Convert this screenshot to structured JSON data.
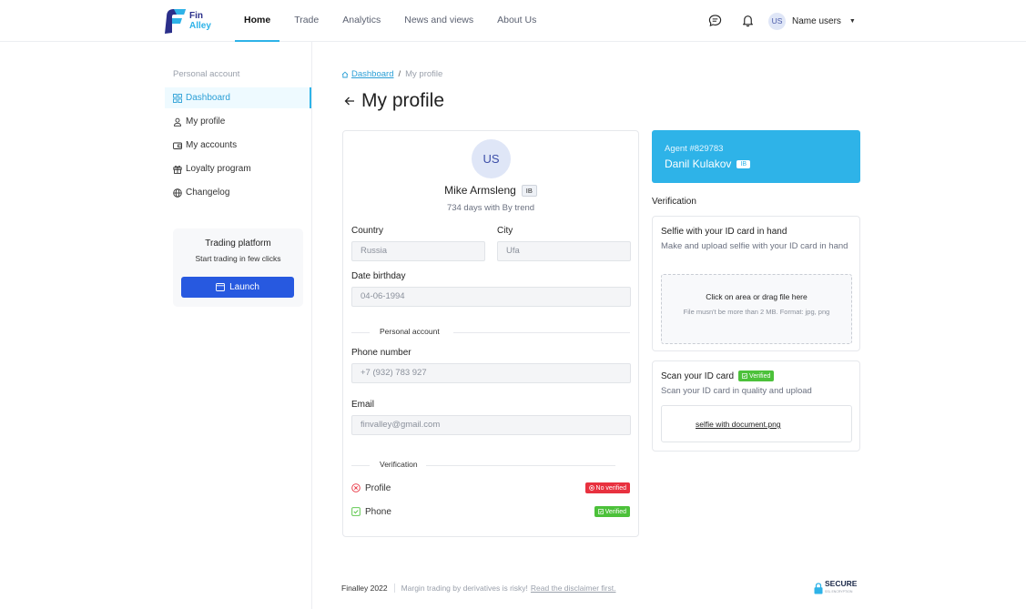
{
  "colors": {
    "accent": "#2eb3e8",
    "primary_button": "#2759e0",
    "danger": "#e8313f",
    "success": "#4cc13a"
  },
  "header": {
    "logo": {
      "line1": "Fin",
      "line2": "Alley"
    },
    "nav": [
      "Home",
      "Trade",
      "Analytics",
      "News and views",
      "About Us"
    ],
    "active_nav": "Home",
    "icons": [
      "chat-icon",
      "bell-icon"
    ],
    "user": {
      "initials": "US",
      "name": "Name users"
    }
  },
  "sidebar": {
    "title": "Personal account",
    "items": [
      {
        "label": "Dashboard",
        "icon": "grid-icon",
        "active": true
      },
      {
        "label": "My profile",
        "icon": "user-icon",
        "active": false
      },
      {
        "label": "My accounts",
        "icon": "wallet-icon",
        "active": false
      },
      {
        "label": "Loyalty program",
        "icon": "gift-icon",
        "active": false
      },
      {
        "label": "Changelog",
        "icon": "globe-icon",
        "active": false
      }
    ],
    "trading": {
      "title": "Trading platform",
      "subtitle": "Start trading in few clicks",
      "button": "Launch"
    }
  },
  "breadcrumb": {
    "link": "Dashboard",
    "current": "My profile"
  },
  "page_title": "My profile",
  "profile": {
    "initials": "US",
    "name": "Mike Armsleng",
    "tag": "IB",
    "days": "734 days with By trend",
    "fields": {
      "country_label": "Country",
      "country_value": "Russia",
      "city_label": "City",
      "city_value": "Ufa",
      "birthday_label": "Date birthday",
      "birthday_value": "04-06-1994",
      "section_personal": "Personal account",
      "phone_label": "Phone number",
      "phone_value": "+7 (932) 783 927",
      "email_label": "Email",
      "email_value": "finvalley@gmail.com",
      "section_verification": "Verification"
    },
    "verification": [
      {
        "label": "Profile",
        "status": "No verified"
      },
      {
        "label": "Phone",
        "status": "Verified"
      }
    ]
  },
  "agent": {
    "number": "Agent #829783",
    "name": "Danil Kulakov",
    "tag": "IB"
  },
  "verification_panel": {
    "title": "Verification",
    "selfie": {
      "title": "Selfie with your ID card in hand",
      "desc": "Make and upload selfie with your ID card in hand",
      "drop_main": "Click on area or drag file here",
      "drop_sub": "File musn't be more than 2 MB. Format: jpg, png"
    },
    "scan": {
      "title": "Scan your ID card",
      "badge": "Verified",
      "desc": "Scan your ID card in quality and upload",
      "file": "selfie with document.png"
    }
  },
  "footer": {
    "copyright": "Finalley 2022",
    "disclaimer": "Margin trading by derivatives is risky!",
    "disclaimer_link": "Read the disclaimer first.",
    "secure": "SECURE",
    "secure_sub": "SSL ENCRYPTION"
  }
}
